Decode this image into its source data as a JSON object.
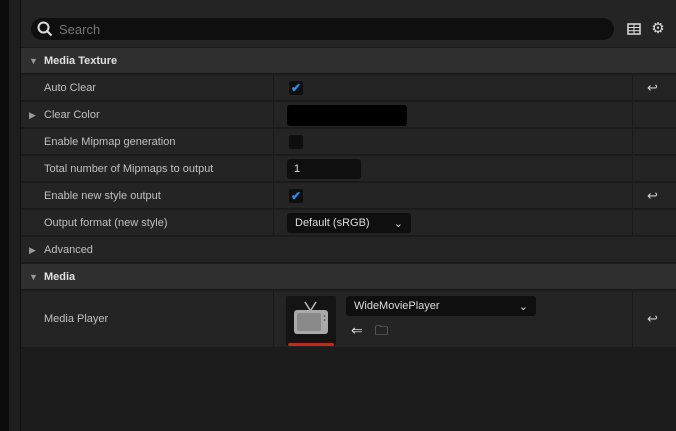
{
  "search": {
    "placeholder": "Search"
  },
  "toolbar": {
    "table_icon": "table-view-icon",
    "settings_icon": "gear-icon"
  },
  "sections": {
    "media_texture": {
      "title": "Media Texture",
      "auto_clear": {
        "label": "Auto Clear",
        "checked": true
      },
      "clear_color": {
        "label": "Clear Color",
        "color": "#000000"
      },
      "enable_mipmap": {
        "label": "Enable Mipmap generation",
        "checked": false
      },
      "total_mipmaps": {
        "label": "Total number of Mipmaps to output",
        "value": "1"
      },
      "enable_new_style": {
        "label": "Enable new style output",
        "checked": true
      },
      "output_format": {
        "label": "Output format (new style)",
        "value": "Default (sRGB)"
      },
      "advanced": {
        "label": "Advanced"
      }
    },
    "media": {
      "title": "Media",
      "media_player": {
        "label": "Media Player",
        "value": "WideMoviePlayer"
      }
    }
  },
  "colors": {
    "accent": "#2b8cf0",
    "asset_underline": "#c0291b"
  }
}
